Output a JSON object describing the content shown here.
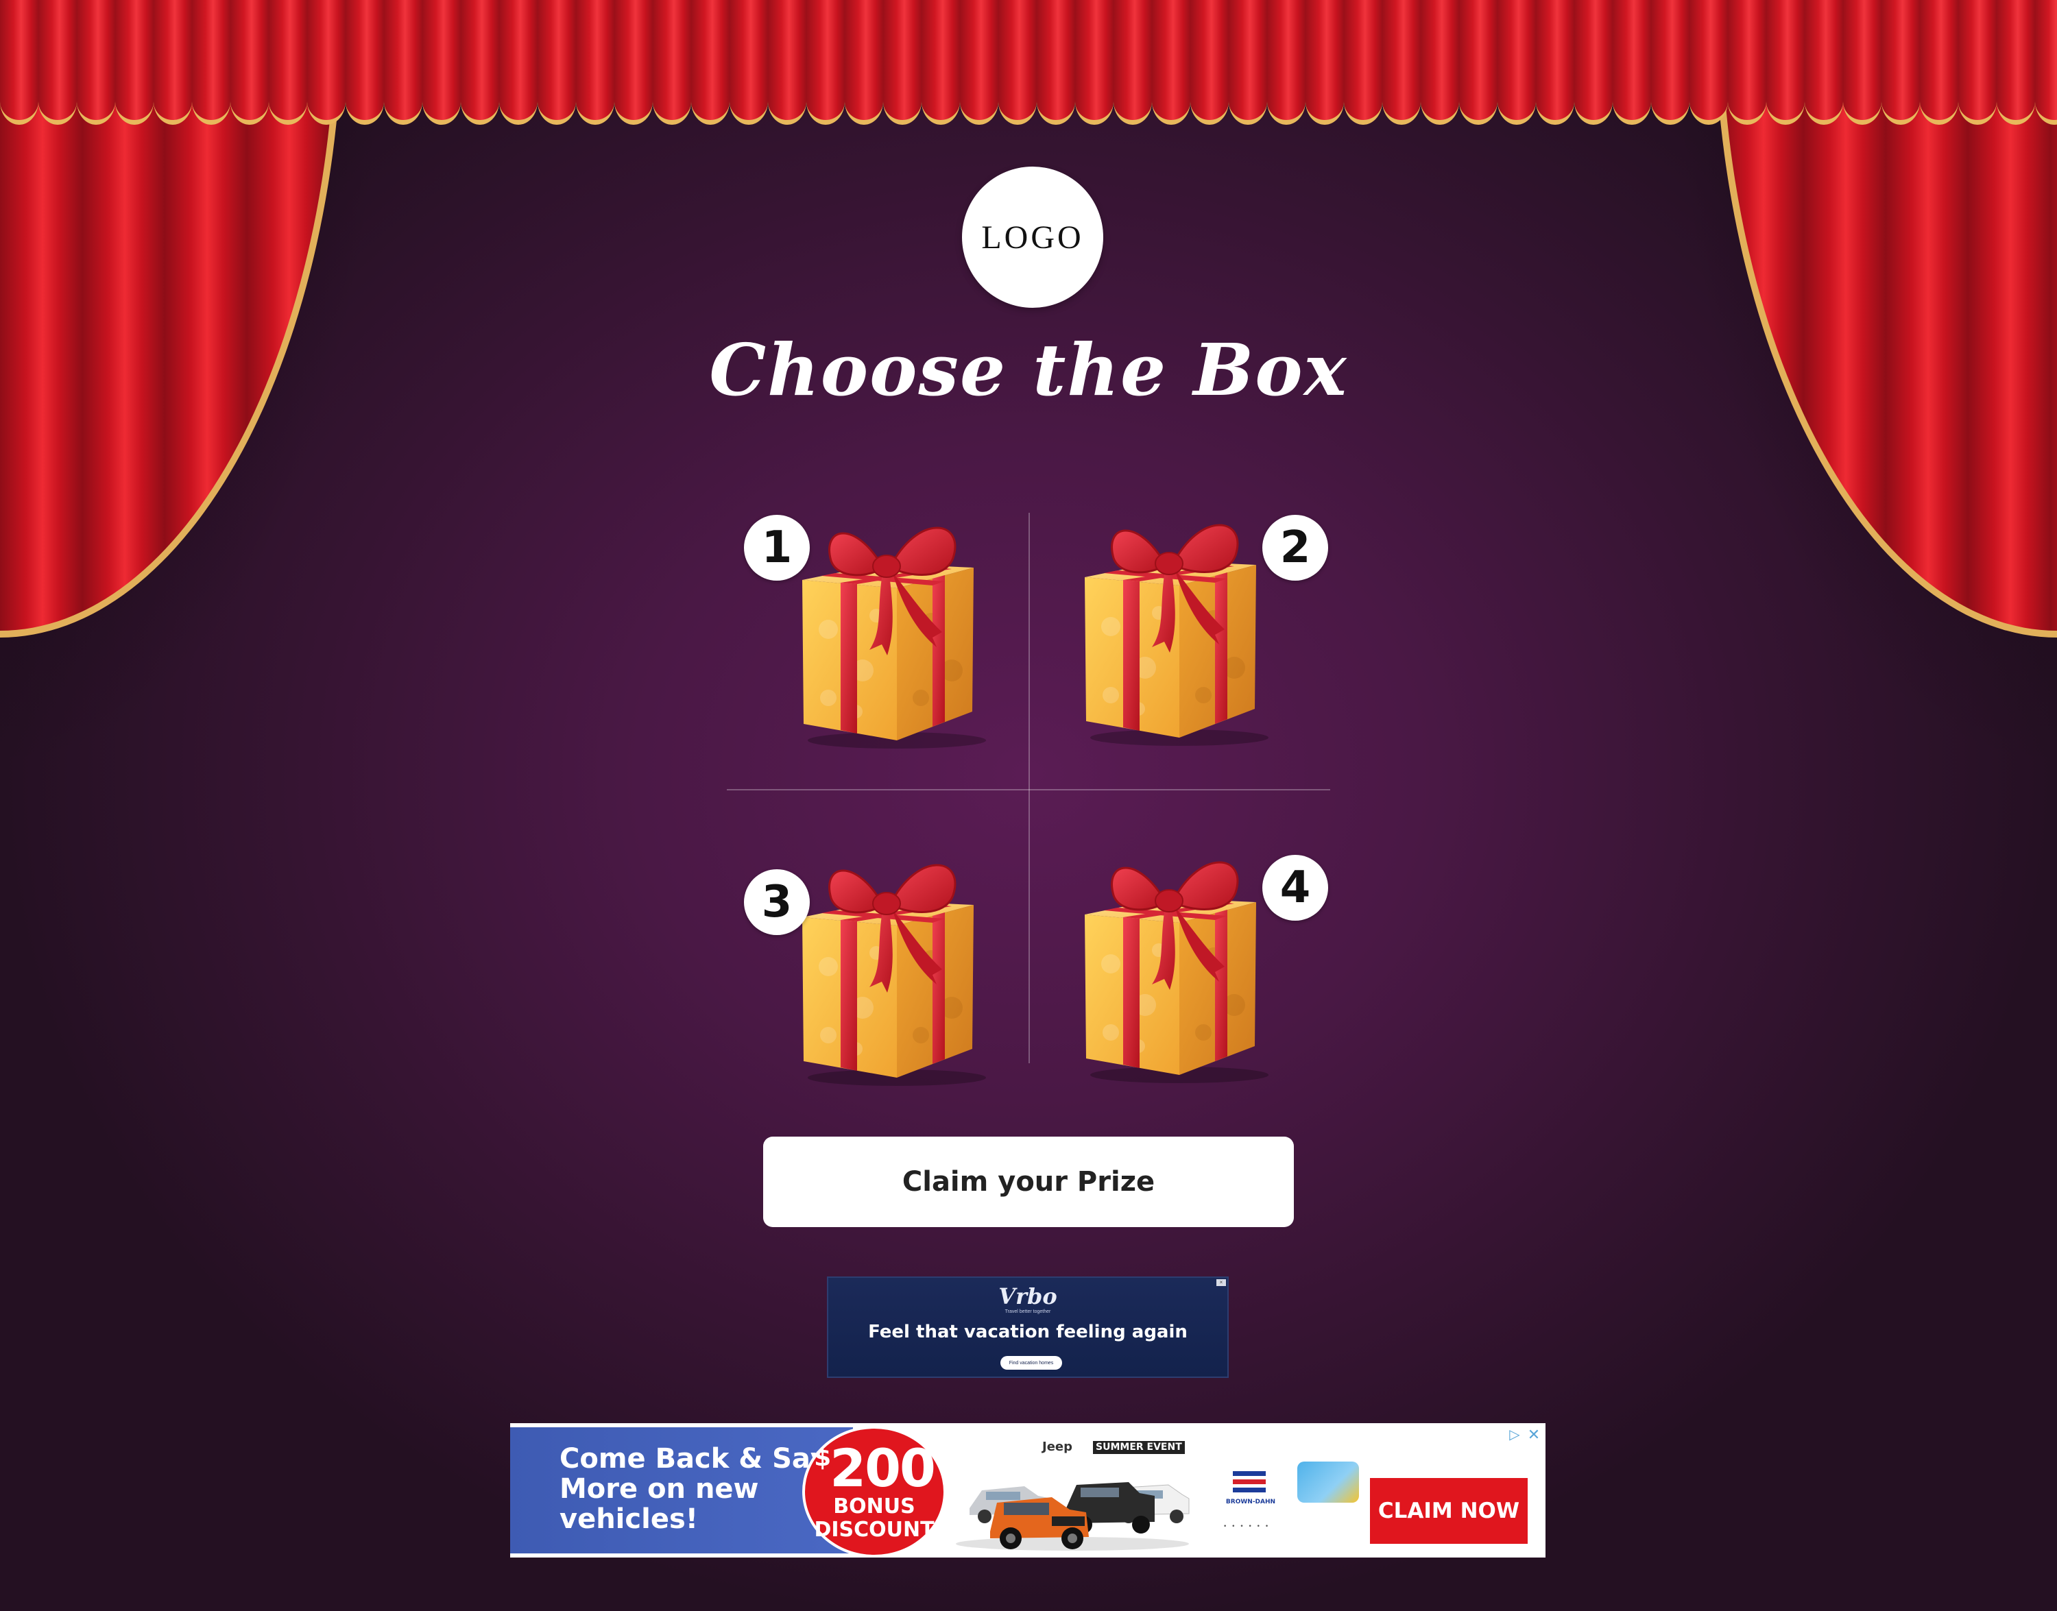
{
  "page": {
    "logo_text": "LOGO",
    "title": "Choose the Box"
  },
  "gifts": [
    {
      "number": "1"
    },
    {
      "number": "2"
    },
    {
      "number": "3"
    },
    {
      "number": "4"
    }
  ],
  "claim_button": {
    "label": "Claim your Prize"
  },
  "ad_top": {
    "brand": "Vrbo",
    "tagline": "Travel better together",
    "headline": "Feel that vacation feeling again",
    "button": "Find vacation homes",
    "close": "×"
  },
  "ad_bottom": {
    "headline": "Come Back & Save More on new vehicles!",
    "amount": "200",
    "currency": "$",
    "bonus_line1": "BONUS",
    "bonus_line2": "DISCOUNT",
    "brand_badge_1": "Jeep",
    "brand_badge_2": "SUMMER EVENT",
    "dealer": "BROWN-DAHN",
    "claim_label": "CLAIM NOW",
    "adchoices_icon": "▷",
    "close_icon": "✕"
  },
  "colors": {
    "curtain_red": "#c8131f",
    "curtain_trim": "#e2b05a",
    "background_purple": "#4a1845",
    "gift_gold": "#f2a93b",
    "ribbon_red": "#d2202c",
    "ad_red": "#e0161e",
    "ad_blue": "#4a68c3"
  }
}
